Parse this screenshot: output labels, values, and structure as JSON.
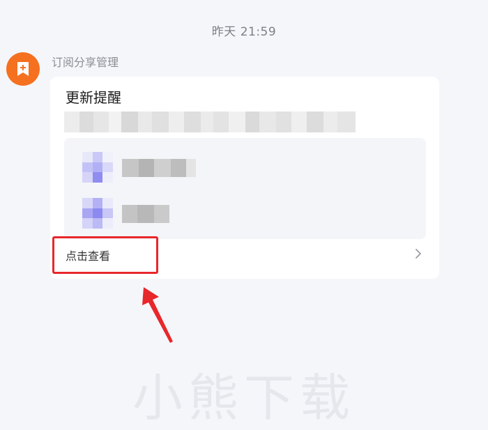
{
  "timestamp": "昨天 21:59",
  "sender": {
    "name": "订阅分享管理",
    "avatar_icon": "bookmark-plus-icon",
    "avatar_color": "#f5711f"
  },
  "card": {
    "title": "更新提醒",
    "items": [
      {
        "icon": "thumbnail-icon"
      },
      {
        "icon": "thumbnail-icon"
      }
    ],
    "view_label": "点击查看",
    "chevron_icon": "chevron-right-icon"
  },
  "annotation": {
    "highlight_color": "#e8272b"
  },
  "watermark": "小熊下载"
}
